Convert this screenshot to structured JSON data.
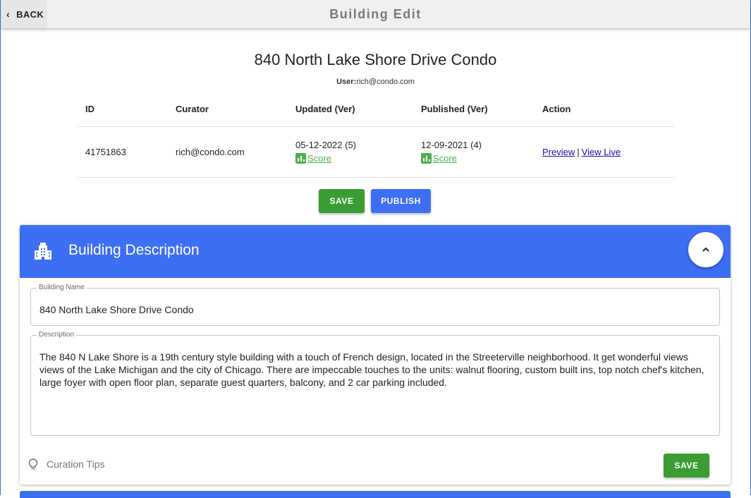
{
  "appbar": {
    "back_label": "BACK",
    "title": "Building Edit"
  },
  "header": {
    "building_title": "840 North Lake Shore Drive Condo",
    "user_label": "User:",
    "user_value": "rich@condo.com"
  },
  "table": {
    "headers": [
      "ID",
      "Curator",
      "Updated (Ver)",
      "Published (Ver)",
      "Action"
    ],
    "row": {
      "id": "41751863",
      "curator": "rich@condo.com",
      "updated": "05-12-2022 (5)",
      "published": "12-09-2021 (4)",
      "score_label": "Score",
      "preview_label": "Preview",
      "separator": "|",
      "view_live_label": "View Live"
    }
  },
  "buttons": {
    "save": "SAVE",
    "publish": "PUBLISH"
  },
  "card": {
    "title": "Building Description",
    "building_name_label": "Building Name",
    "building_name_value": "840 North Lake Shore Drive Condo",
    "description_label": "Description",
    "description_value": "The 840 N Lake Shore is a 19th century style building with a touch of French design, located in the Streeterville neighborhood. It get wonderful views views of the Lake Michigan and the city of Chicago. There are impeccable touches to the units: walnut flooring, custom built ins, top notch chef's kitchen, large foyer with open floor plan, separate guest quarters, balcony, and 2 car parking included.",
    "tips_label": "Curation Tips",
    "save_label": "SAVE"
  },
  "colors": {
    "primary_blue": "#3d6ff5",
    "save_green": "#3b9c34",
    "score_green": "#4caf50"
  },
  "icons": [
    "chevron-left-icon",
    "score-bar-chart-icon",
    "building-icon",
    "chevron-up-icon",
    "lightbulb-icon"
  ]
}
